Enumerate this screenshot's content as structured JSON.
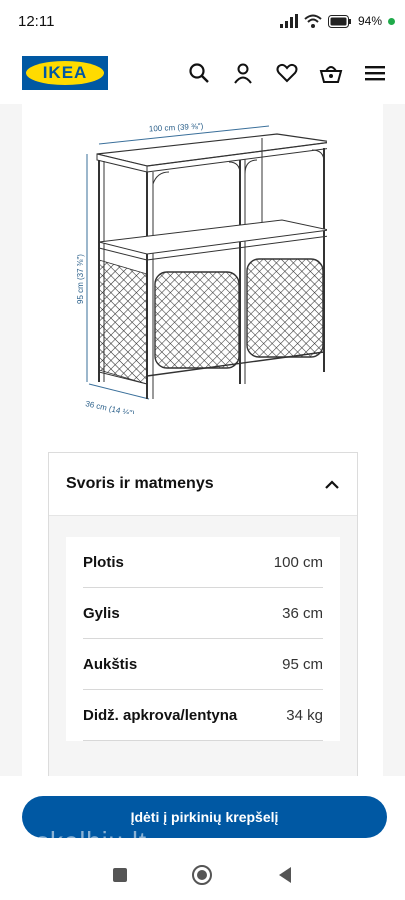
{
  "status_bar": {
    "time": "12:11",
    "battery": "94%"
  },
  "header": {
    "logo_text": "IKEA",
    "icons": [
      "search-icon",
      "user-icon",
      "heart-icon",
      "basket-icon",
      "menu-icon"
    ]
  },
  "drawing": {
    "width_label": "100 cm (39 ⅜\")",
    "height_label": "95 cm (37 ⅜\")",
    "depth_label": "36 cm (14 ⅛\")"
  },
  "accordion": {
    "title": "Svoris ir matmenys",
    "rows": [
      {
        "label": "Plotis",
        "value": "100 cm"
      },
      {
        "label": "Gylis",
        "value": "36 cm"
      },
      {
        "label": "Aukštis",
        "value": "95 cm"
      },
      {
        "label": "Didž. apkrova/lentyna",
        "value": "34 kg"
      }
    ]
  },
  "cart": {
    "button_label": "Įdėti į pirkinių krepšelį"
  },
  "watermark": "skelbiu.lt",
  "colors": {
    "brand_blue": "#0058a3",
    "brand_yellow": "#ffdb00"
  }
}
